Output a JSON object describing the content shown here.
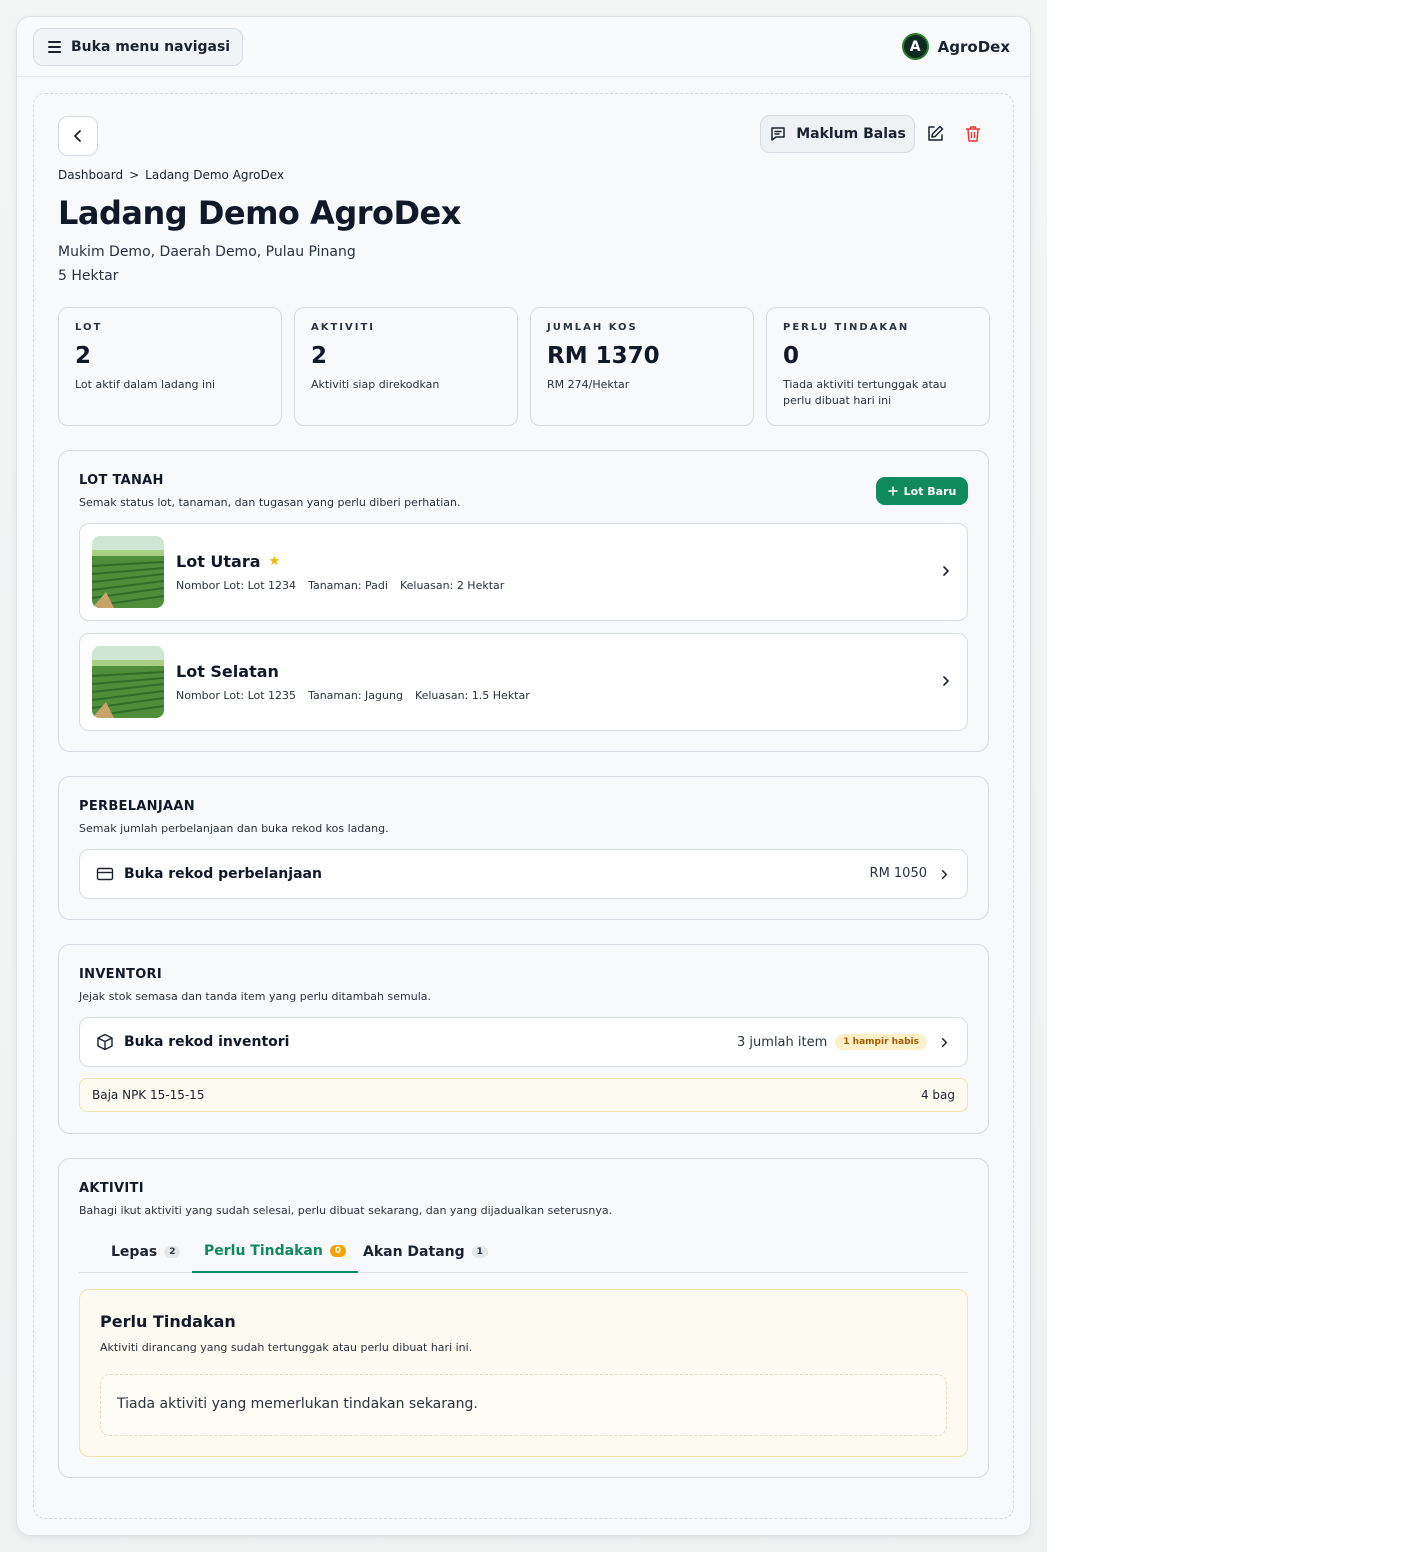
{
  "topbar": {
    "nav_button_label": "Buka menu navigasi",
    "brand_name": "AgroDex",
    "brand_logo_letter": "A"
  },
  "header": {
    "feedback_label": "Maklum Balas",
    "breadcrumb": [
      "Dashboard",
      "Ladang Demo AgroDex"
    ],
    "breadcrumb_separator": ">",
    "title": "Ladang Demo AgroDex",
    "location": "Mukim Demo, Daerah Demo, Pulau Pinang",
    "area": "5 Hektar"
  },
  "stats": [
    {
      "label": "LOT",
      "value": "2",
      "desc": "Lot aktif dalam ladang ini"
    },
    {
      "label": "AKTIVITI",
      "value": "2",
      "desc": "Aktiviti siap direkodkan"
    },
    {
      "label": "JUMLAH KOS",
      "value": "RM 1370",
      "desc": "RM 274/Hektar"
    },
    {
      "label": "PERLU TINDAKAN",
      "value": "0",
      "desc": "Tiada aktiviti tertunggak atau perlu dibuat hari ini"
    }
  ],
  "lots": {
    "title": "LOT TANAH",
    "desc": "Semak status lot, tanaman, dan tugasan yang perlu diberi perhatian.",
    "new_button": "Lot Baru",
    "items": [
      {
        "name": "Lot Utara",
        "starred": true,
        "number": "Nombor Lot: Lot 1234",
        "crop": "Tanaman: Padi",
        "area": "Keluasan: 2 Hektar"
      },
      {
        "name": "Lot Selatan",
        "starred": false,
        "number": "Nombor Lot: Lot 1235",
        "crop": "Tanaman: Jagung",
        "area": "Keluasan: 1.5 Hektar"
      }
    ]
  },
  "expenses": {
    "title": "PERBELANJAAN",
    "desc": "Semak jumlah perbelanjaan dan buka rekod kos ladang.",
    "link_label": "Buka rekod perbelanjaan",
    "total": "RM 1050"
  },
  "inventory": {
    "title": "INVENTORI",
    "desc": "Jejak stok semasa dan tanda item yang perlu ditambah semula.",
    "link_label": "Buka rekod inventori",
    "count_text": "3 jumlah item",
    "low_badge": "1 hampir habis",
    "low_items": [
      {
        "name": "Baja NPK 15-15-15",
        "qty": "4 bag"
      }
    ]
  },
  "activities": {
    "title": "AKTIVITI",
    "desc": "Bahagi ikut aktiviti yang sudah selesai, perlu dibuat sekarang, dan yang dijadualkan seterusnya.",
    "tabs": [
      {
        "label": "Lepas",
        "count": "2"
      },
      {
        "label": "Perlu Tindakan",
        "count": "0"
      },
      {
        "label": "Akan Datang",
        "count": "1"
      }
    ],
    "active_tab": "Perlu Tindakan",
    "panel_title": "Perlu Tindakan",
    "panel_desc": "Aktiviti dirancang yang sudah tertunggak atau perlu dibuat hari ini.",
    "empty_text": "Tiada aktiviti yang memerlukan tindakan sekarang."
  },
  "colors": {
    "accent": "#0f8a5f",
    "danger": "#e53935",
    "star": "#f5b400",
    "warning_badge": "#f5a300"
  }
}
